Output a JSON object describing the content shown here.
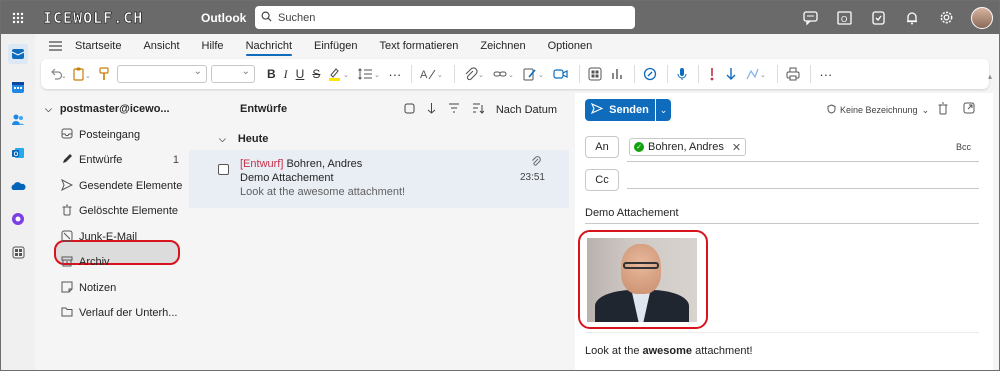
{
  "header": {
    "brand": "ICEWOLF.CH",
    "app_name": "Outlook",
    "search_placeholder": "Suchen"
  },
  "ribbon": {
    "tabs": [
      {
        "label": "Startseite"
      },
      {
        "label": "Ansicht"
      },
      {
        "label": "Hilfe"
      },
      {
        "label": "Nachricht",
        "active": true
      },
      {
        "label": "Einfügen"
      },
      {
        "label": "Text formatieren"
      },
      {
        "label": "Zeichnen"
      },
      {
        "label": "Optionen"
      }
    ]
  },
  "folders": {
    "account": "postmaster@icewo...",
    "items": [
      {
        "label": "Posteingang",
        "icon": "inbox-icon"
      },
      {
        "label": "Entwürfe",
        "count": "1",
        "icon": "pencil-icon",
        "selected": true
      },
      {
        "label": "Gesendete Elemente",
        "icon": "send-icon"
      },
      {
        "label": "Gelöschte Elemente",
        "icon": "trash-icon"
      },
      {
        "label": "Junk-E-Mail",
        "icon": "junk-icon"
      },
      {
        "label": "Archiv",
        "icon": "archive-icon"
      },
      {
        "label": "Notizen",
        "icon": "note-icon"
      },
      {
        "label": "Verlauf der Unterh...",
        "icon": "folder-icon"
      }
    ]
  },
  "message_list": {
    "title": "Entwürfe",
    "sort_label": "Nach Datum",
    "group": "Heute",
    "messages": [
      {
        "draft_tag": "[Entwurf]",
        "sender": "Bohren, Andres",
        "subject": "Demo Attachement",
        "preview": "Look at the awesome attachment!",
        "time": "23:51"
      }
    ]
  },
  "compose": {
    "send_label": "Senden",
    "sensitivity_label": "Keine Bezeichnung",
    "to_label": "An",
    "cc_label": "Cc",
    "bcc_label": "Bcc",
    "recipient": "Bohren, Andres",
    "subject": "Demo Attachement",
    "body_before": "Look at the ",
    "body_bold": "awesome",
    "body_after": " attachment!"
  },
  "colors": {
    "accent": "#0f6cbd",
    "highlight_red": "#d7141e",
    "draft_red": "#c4314b"
  }
}
